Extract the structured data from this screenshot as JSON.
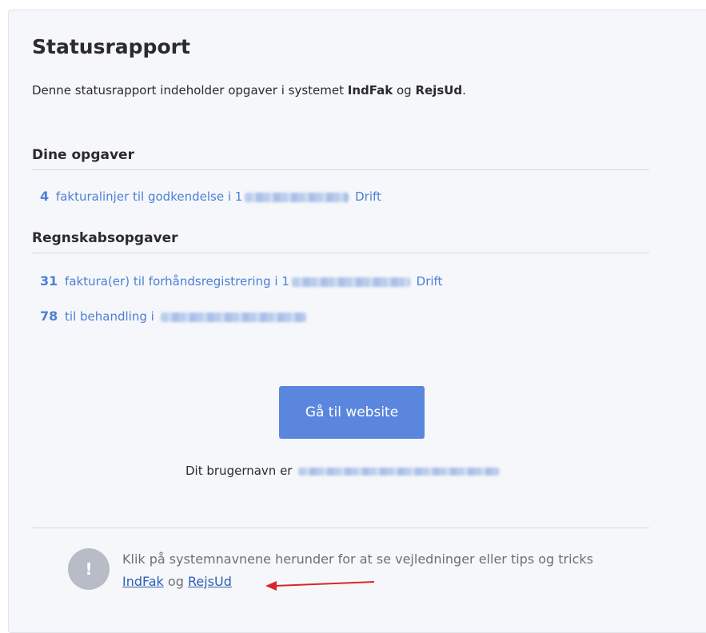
{
  "report": {
    "title": "Statusrapport",
    "intro_prefix": "Denne statusrapport indeholder opgaver i systemet ",
    "system1": "IndFak",
    "intro_mid": " og ",
    "system2": "RejsUd",
    "intro_suffix": "."
  },
  "dine_opgaver": {
    "heading": "Dine opgaver",
    "items": [
      {
        "count": "4",
        "text_before": "fakturalinjer til godkendelse i",
        "prefix": "1",
        "text_after": "Drift"
      }
    ]
  },
  "regnskabsopgaver": {
    "heading": "Regnskabsopgaver",
    "items": [
      {
        "count": "31",
        "text_before": "faktura(er) til forhåndsregistrering i",
        "prefix": "1",
        "text_after": "Drift"
      },
      {
        "count": "78",
        "text_before": "til behandling i",
        "prefix": "",
        "text_after": ""
      }
    ]
  },
  "cta": {
    "label": "Gå til website"
  },
  "username": {
    "label": "Dit brugernavn er"
  },
  "footer": {
    "message": "Klik på systemnavnene herunder for at se vejledninger eller tips og tricks",
    "link1": "IndFak",
    "connector": "og",
    "link2": "RejsUd"
  },
  "colors": {
    "accent": "#5b86dd",
    "link": "#4c7fd6",
    "annotation_arrow": "#d9262b"
  }
}
